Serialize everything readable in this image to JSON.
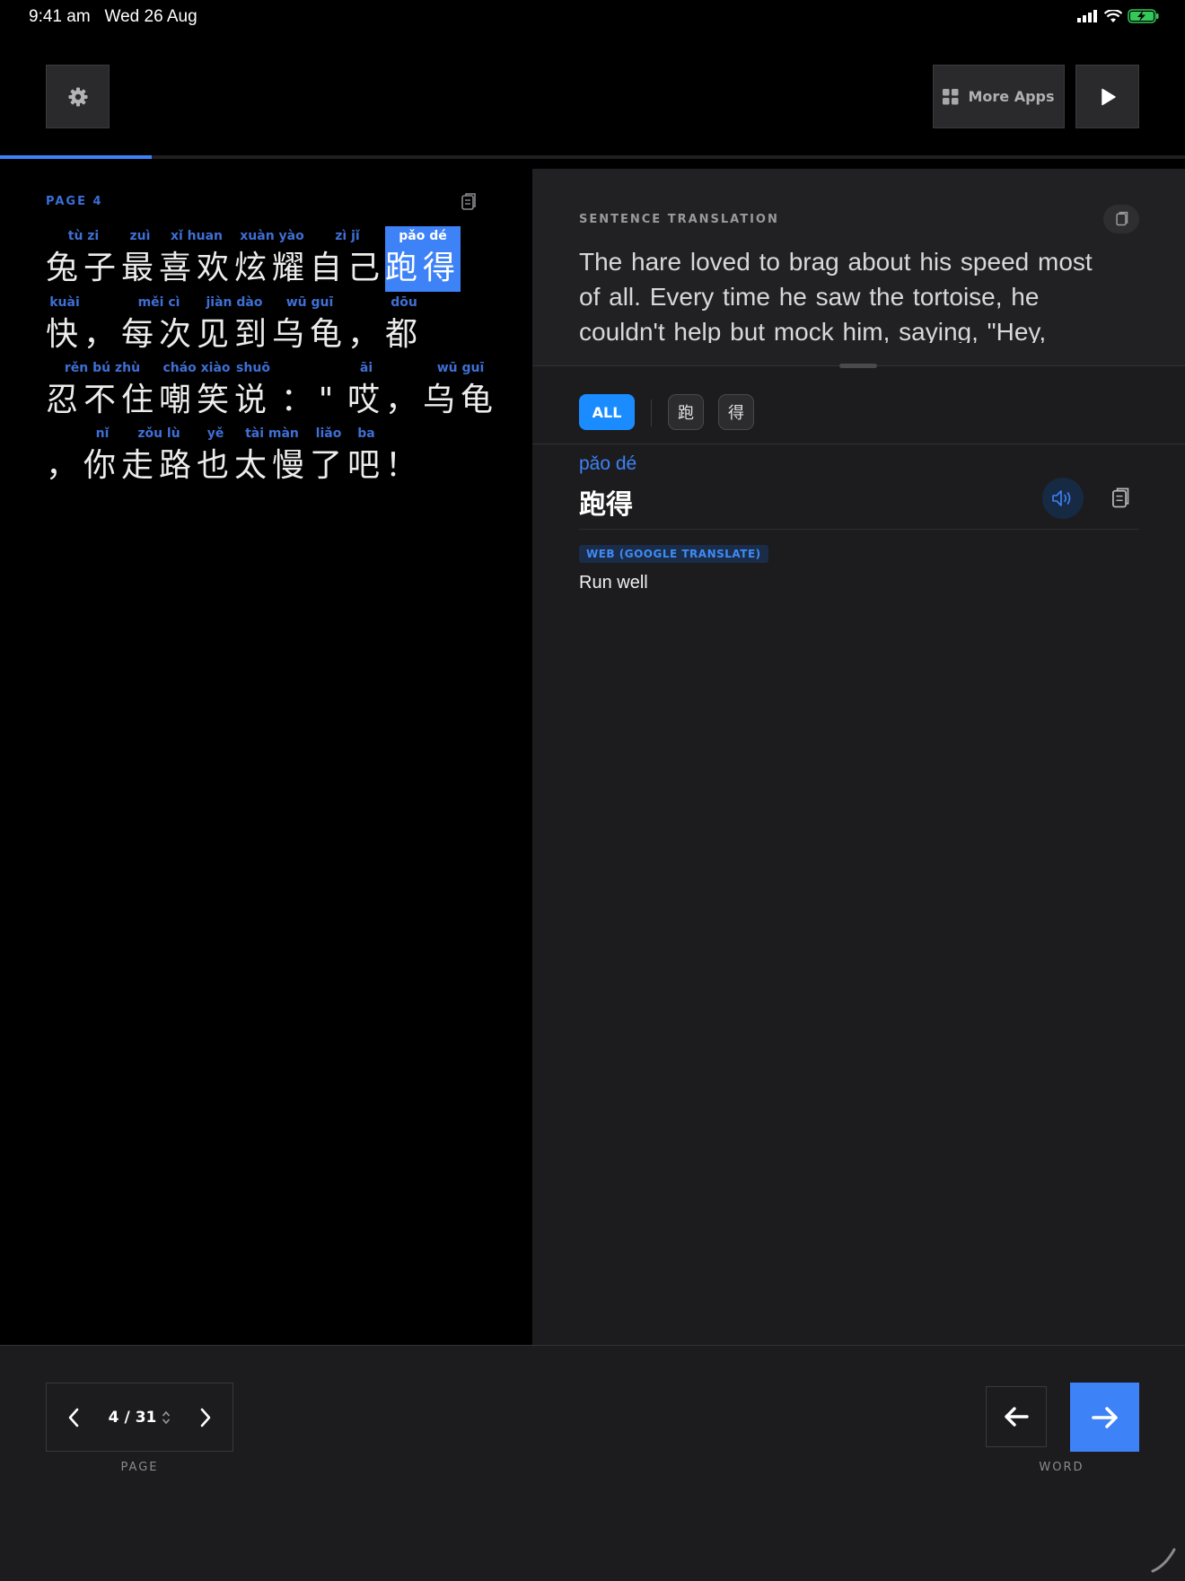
{
  "status_bar": {
    "time": "9:41 am",
    "date": "Wed 26 Aug"
  },
  "toolbar": {
    "more_apps_label": "More Apps"
  },
  "reader": {
    "page_label": "PAGE 4",
    "progress_fraction": 0.128,
    "lines": [
      [
        {
          "py": "tù zi",
          "hz": "兔子"
        },
        {
          "py": "zuì",
          "hz": "最"
        },
        {
          "py": "xǐ huan",
          "hz": "喜欢"
        },
        {
          "py": "xuàn yào",
          "hz": "炫耀"
        },
        {
          "py": "zì jǐ",
          "hz": "自己"
        },
        {
          "py": "pǎo dé",
          "hz": "跑得",
          "selected": true
        }
      ],
      [
        {
          "py": "kuài",
          "hz": "快"
        },
        {
          "py": "",
          "hz": "，"
        },
        {
          "py": "měi cì",
          "hz": "每次"
        },
        {
          "py": "jiàn dào",
          "hz": "见到"
        },
        {
          "py": "wū guī",
          "hz": "乌龟"
        },
        {
          "py": "",
          "hz": "，"
        },
        {
          "py": "dōu",
          "hz": "都"
        }
      ],
      [
        {
          "py": "rěn bú zhù",
          "hz": "忍不住"
        },
        {
          "py": "cháo xiào",
          "hz": "嘲笑"
        },
        {
          "py": "shuō",
          "hz": "说"
        },
        {
          "py": "",
          "hz": "：\""
        },
        {
          "py": "āi",
          "hz": "哎"
        },
        {
          "py": "",
          "hz": "，"
        },
        {
          "py": "wū guī",
          "hz": "乌龟"
        }
      ],
      [
        {
          "py": "",
          "hz": "，"
        },
        {
          "py": "nǐ",
          "hz": "你"
        },
        {
          "py": "zǒu lù",
          "hz": "走路"
        },
        {
          "py": "yě",
          "hz": "也"
        },
        {
          "py": "tài màn",
          "hz": "太慢"
        },
        {
          "py": "liǎo",
          "hz": "了"
        },
        {
          "py": "ba",
          "hz": "吧"
        },
        {
          "py": "",
          "hz": "！"
        }
      ]
    ]
  },
  "sentence": {
    "label": "SENTENCE TRANSLATION",
    "text": "The hare loved to brag about his speed most of all. Every time he saw the tortoise, he couldn't help but mock him, saying, \"Hey,"
  },
  "filters": {
    "all_label": "ALL",
    "chars": [
      "跑",
      "得"
    ]
  },
  "word": {
    "pinyin": "pǎo dé",
    "hanzi": "跑得",
    "source": "WEB (GOOGLE TRANSLATE)",
    "translation": "Run well"
  },
  "pager": {
    "current": "4",
    "separator": "/",
    "total": "31",
    "caption": "PAGE"
  },
  "word_nav": {
    "caption": "WORD"
  },
  "colors": {
    "accent": "#3e82f7",
    "chip_blue": "#1a8cff",
    "panel": "#1c1c1e"
  },
  "icons": [
    "gear-icon",
    "grid-icon",
    "play-icon",
    "copy-icon",
    "speaker-icon",
    "chevron-left-icon",
    "chevron-right-icon",
    "sort-icon",
    "arrow-left-icon",
    "arrow-right-icon"
  ]
}
